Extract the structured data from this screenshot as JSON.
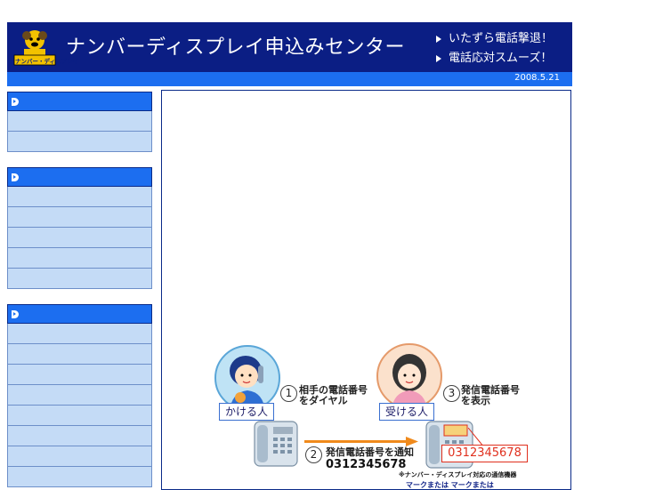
{
  "header": {
    "site_title": "ナンバーディスプレイ申込みセンター",
    "logo_text": "ナンバー・ディスプレイ",
    "taglines": [
      "いたずら電話撃退！",
      "電話応対スムーズ！"
    ]
  },
  "date": "2008.5.21",
  "sidebar": {
    "menus": [
      {
        "item_count": 2
      },
      {
        "item_count": 5
      },
      {
        "item_count": 8
      }
    ]
  },
  "diagram": {
    "caller_label": "かける人",
    "receiver_label": "受ける人",
    "steps": [
      {
        "num": "1",
        "text": "相手の電話番号\nをダイヤル"
      },
      {
        "num": "2",
        "text": "発信電話番号を通知"
      },
      {
        "num": "3",
        "text": "発信電話番号\nを表示"
      }
    ],
    "phone_number": "0312345678",
    "display_number": "0312345678",
    "note_line1": "※ナンバー・ディスプレイ対応の通信機器",
    "note_line2": "マークまたは マークまたは"
  },
  "colors": {
    "header_bg": "#0b1e84",
    "accent_blue": "#1c6ef0",
    "menu_item_bg": "#c4dbf6",
    "display_red": "#e0301e"
  }
}
